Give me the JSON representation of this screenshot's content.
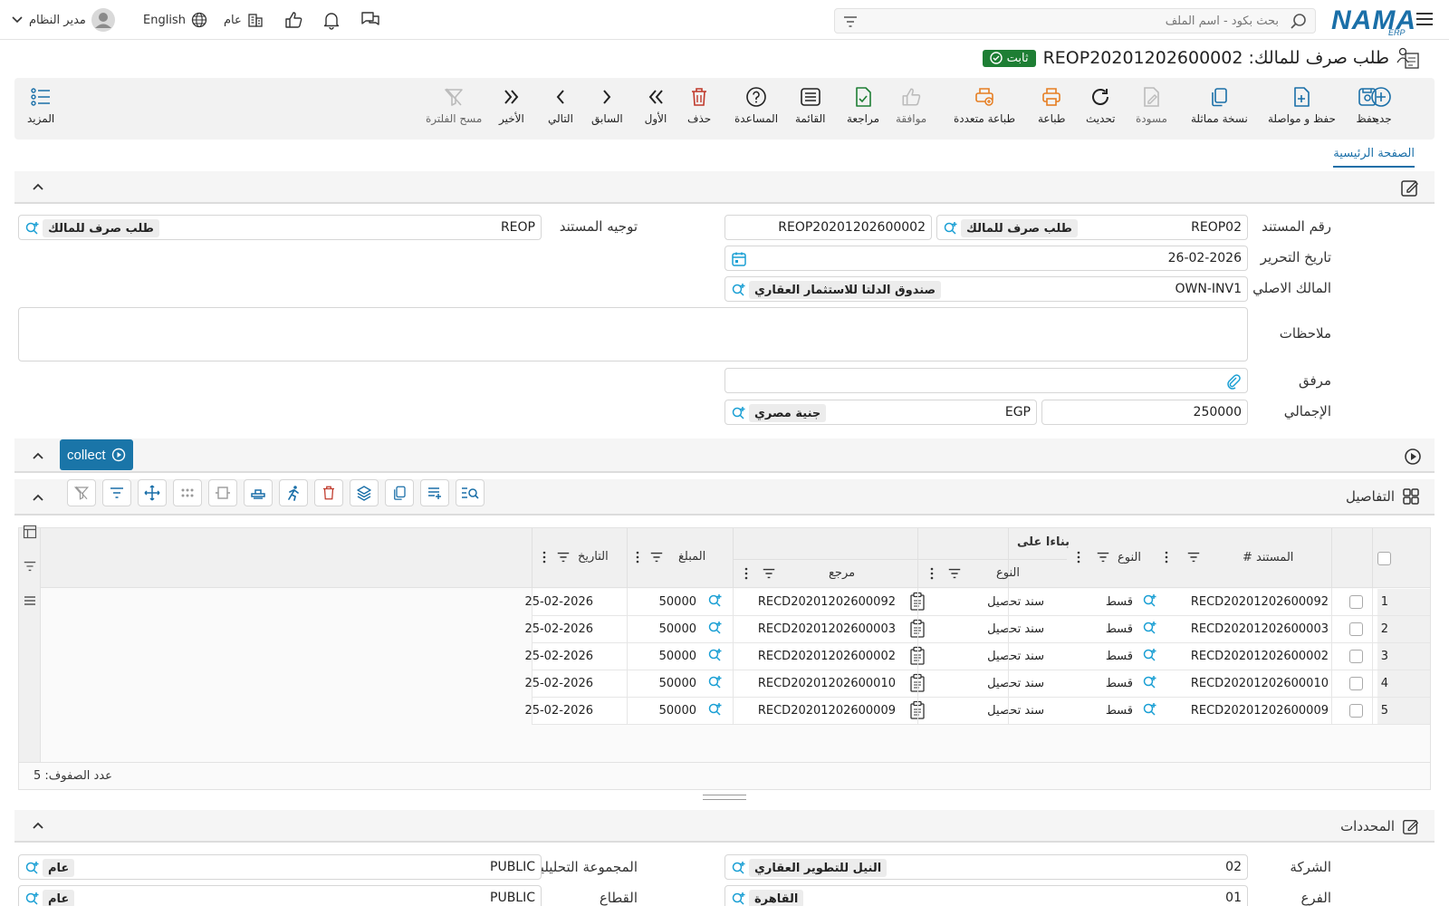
{
  "topbar": {
    "user_name": "مدير النظام",
    "language": "English",
    "branch_label": "عام",
    "search_placeholder": "بحث بكود - اسم الملف",
    "logo": "NAMA",
    "logo_sub": "ERP"
  },
  "header": {
    "title": "طلب صرف للمالك: REOP20201202600002",
    "status": "ثابت"
  },
  "toolbar": {
    "new": "جديد",
    "save": "حفظ",
    "save_continue": "حفظ و مواصلة",
    "copy": "نسخة مماثلة",
    "draft": "مسودة",
    "refresh": "تحديث",
    "print": "طباعة",
    "multi_print": "طباعة متعددة",
    "approve": "موافقة",
    "review": "مراجعة",
    "list": "القائمة",
    "help": "المساعدة",
    "delete": "حذف",
    "first": "الأول",
    "previous": "السابق",
    "next": "التالي",
    "last": "الأخير",
    "clear_filter": "مسح الفلترة",
    "more": "المزيد"
  },
  "tabs": {
    "main": "الصفحة الرئيسية"
  },
  "form": {
    "doc_number_label": "رقم المستند",
    "doc_book_code": "REOP02",
    "doc_book_name": "طلب صرف للمالك",
    "doc_number": "REOP20201202600002",
    "direction_label": "توجيه المستند",
    "direction_code": "REOP",
    "direction_name": "طلب صرف للمالك",
    "date_label": "تاريخ التحرير",
    "date_value": "26-02-2026",
    "owner_label": "المالك الاصلي",
    "owner_code": "OWN-INV1",
    "owner_name": "صندوق الدلتا للاستثمار العقاري",
    "notes_label": "ملاحظات",
    "attachment_label": "مرفق",
    "total_label": "الإجمالي",
    "total_value": "250000",
    "currency_code": "EGP",
    "currency_name": "جنية مصري"
  },
  "actions": {
    "collect": "collect"
  },
  "details": {
    "title": "التفاصيل",
    "headers": {
      "doc": "# المستند",
      "type": "النوع",
      "based_on": "بناءا على",
      "based_type": "النوع",
      "reference": "مرجع",
      "amount": "المبلغ",
      "date": "التاريخ"
    },
    "rows": [
      {
        "n": "1",
        "doc": "RECD20201202600092",
        "type": "قسط",
        "based_type": "سند تحصيل",
        "reference": "RECD20201202600092",
        "amount": "50000",
        "date": "25-02-2026"
      },
      {
        "n": "2",
        "doc": "RECD20201202600003",
        "type": "قسط",
        "based_type": "سند تحصيل",
        "reference": "RECD20201202600003",
        "amount": "50000",
        "date": "25-02-2026"
      },
      {
        "n": "3",
        "doc": "RECD20201202600002",
        "type": "قسط",
        "based_type": "سند تحصيل",
        "reference": "RECD20201202600002",
        "amount": "50000",
        "date": "25-02-2026"
      },
      {
        "n": "4",
        "doc": "RECD20201202600010",
        "type": "قسط",
        "based_type": "سند تحصيل",
        "reference": "RECD20201202600010",
        "amount": "50000",
        "date": "25-02-2026"
      },
      {
        "n": "5",
        "doc": "RECD20201202600009",
        "type": "قسط",
        "based_type": "سند تحصيل",
        "reference": "RECD20201202600009",
        "amount": "50000",
        "date": "25-02-2026"
      }
    ],
    "row_count": "عدد الصفوف: 5"
  },
  "dimensions": {
    "title": "المحددات",
    "company_label": "الشركة",
    "company_code": "02",
    "company_name": "النيل للتطوير العقاري",
    "analysis_label": "المجموعة التحليلية",
    "analysis_code": "PUBLIC",
    "analysis_name": "عام",
    "branch_label": "الفرع",
    "branch_code": "01",
    "branch_name": "القاهرة",
    "sector_label": "القطاع",
    "sector_code": "PUBLIC",
    "sector_name": "عام"
  },
  "colors": {
    "accent": "#1a6fa8",
    "status_green": "#1e7e34",
    "delete_red": "#c0392b",
    "print_orange": "#e67e22"
  }
}
